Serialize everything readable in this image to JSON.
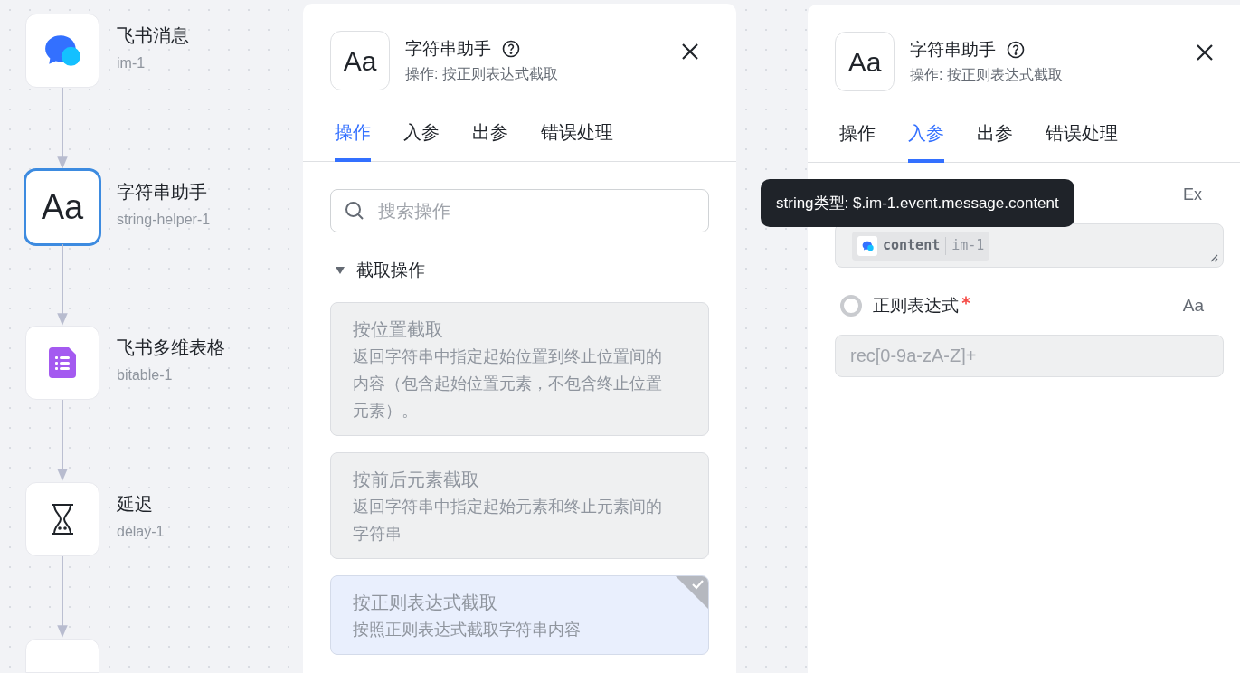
{
  "canvas": {
    "nodes": [
      {
        "kind": "message",
        "title": "飞书消息",
        "id": "im-1",
        "selected": false
      },
      {
        "kind": "string",
        "icon_text": "Aa",
        "title": "字符串助手",
        "id": "string-helper-1",
        "selected": true
      },
      {
        "kind": "table",
        "title": "飞书多维表格",
        "id": "bitable-1",
        "selected": false
      },
      {
        "kind": "delay",
        "title": "延迟",
        "id": "delay-1",
        "selected": false
      }
    ]
  },
  "panels": [
    {
      "icon_text": "Aa",
      "title": "字符串助手",
      "subtitle": "操作: 按正则表达式截取",
      "tabs": [
        {
          "label": "操作",
          "selected": true
        },
        {
          "label": "入参",
          "selected": false
        },
        {
          "label": "出参",
          "selected": false
        },
        {
          "label": "错误处理",
          "selected": false
        }
      ],
      "body": {
        "kind": "operations",
        "search": {
          "placeholder": "搜索操作"
        },
        "section": {
          "title": "截取操作",
          "expanded": true
        },
        "options": [
          {
            "title": "按位置截取",
            "description": "返回字符串中指定起始位置到终止位置间的内容（包含起始位置元素，不包含终止位置元素）。",
            "selected": false
          },
          {
            "title": "按前后元素截取",
            "description": "返回字符串中指定起始元素和终止元素间的字符串",
            "selected": false
          },
          {
            "title": "按正则表达式截取",
            "description": "按照正则表达式截取字符串内容",
            "selected": true
          }
        ]
      }
    },
    {
      "icon_text": "Aa",
      "title": "字符串助手",
      "subtitle": "操作: 按正则表达式截取",
      "tabs": [
        {
          "label": "操作",
          "selected": false
        },
        {
          "label": "入参",
          "selected": true
        },
        {
          "label": "出参",
          "selected": false
        },
        {
          "label": "错误处理",
          "selected": false
        }
      ],
      "body": {
        "kind": "inputs",
        "tooltip": "string类型: $.im-1.event.message.content",
        "fields": [
          {
            "kind": "reference",
            "action": "Ex",
            "chip": {
              "name": "content",
              "source": "im-1"
            }
          },
          {
            "kind": "text",
            "label": "正则表达式",
            "required": true,
            "checked": false,
            "action": "Aa",
            "value": "rec[0-9a-zA-Z]+"
          }
        ]
      }
    }
  ]
}
